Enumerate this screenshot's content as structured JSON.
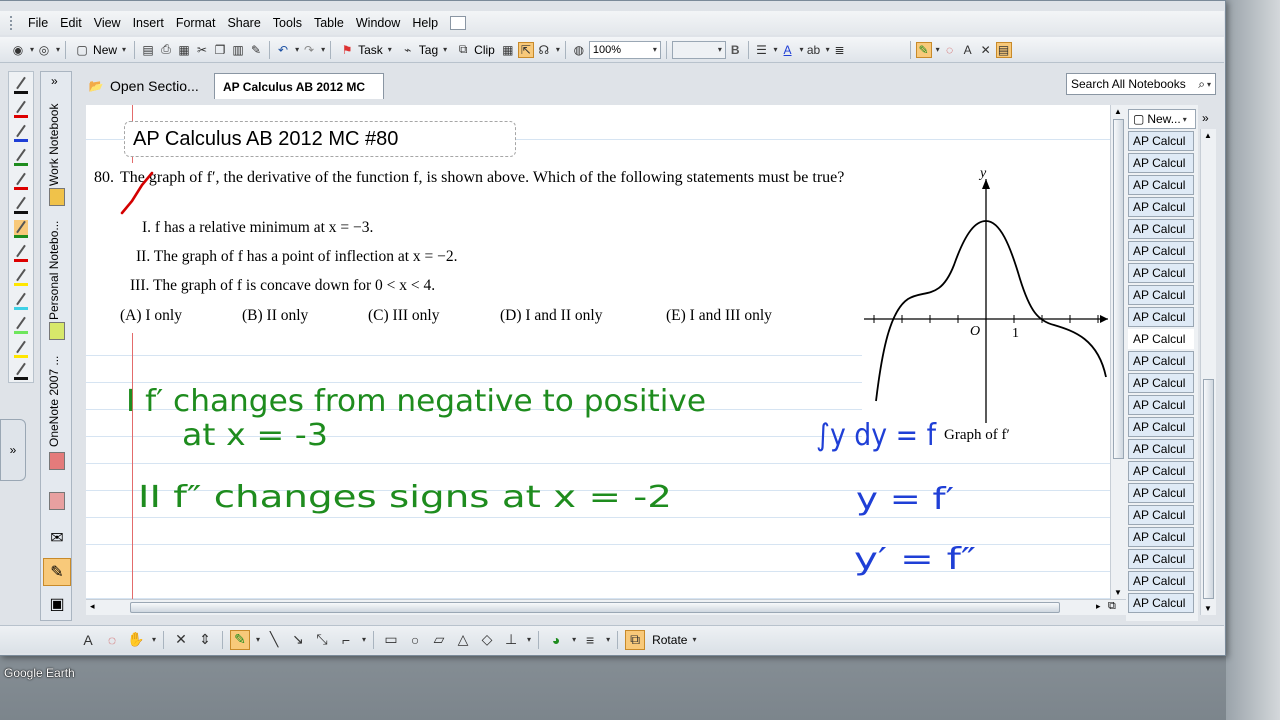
{
  "menu": [
    "File",
    "Edit",
    "View",
    "Insert",
    "Format",
    "Share",
    "Tools",
    "Table",
    "Window",
    "Help"
  ],
  "toolbar": {
    "new_label": "New",
    "task_label": "Task",
    "tag_label": "Tag",
    "clip_label": "Clip",
    "zoom_value": "100%",
    "bold_label": "B"
  },
  "tabs": {
    "open_sections": "Open Sectio...",
    "active_section": "AP Calculus AB 2012 MC"
  },
  "search": {
    "placeholder": "Search All Notebooks"
  },
  "navbar": {
    "notebooks": [
      "Work Notebook",
      "Personal Notebo...",
      "OneNote 2007 ..."
    ]
  },
  "page": {
    "title": "AP Calculus AB 2012 MC #80",
    "question_number": "80.",
    "question_stem": "The graph of f′, the derivative of the function f, is shown above. Which of the following statements must be true?",
    "statements": [
      "I. f has a relative minimum at x = −3.",
      "II. The graph of f has a point of inflection at x = −2.",
      "III. The graph of f is concave down for 0 < x < 4."
    ],
    "choices": [
      "(A) I only",
      "(B) II only",
      "(C) III only",
      "(D) I and II only",
      "(E) I and III only"
    ],
    "graph": {
      "y_label": "y",
      "origin_label": "O",
      "tick_label": "1",
      "caption": "Graph of f′"
    },
    "handwriting": {
      "line1": "I  f′ changes from negative to positive",
      "line2": "at x = -3",
      "line3": "II  f″ changes signs at x = -2",
      "side1": "∫y dy = f",
      "side2": "y = f′",
      "side3": "y′ = f″"
    }
  },
  "pagelist": {
    "new_label": "New...",
    "items": [
      "AP Calcul",
      "AP Calcul",
      "AP Calcul",
      "AP Calcul",
      "AP Calcul",
      "AP Calcul",
      "AP Calcul",
      "AP Calcul",
      "AP Calcul",
      "AP Calcul",
      "AP Calcul",
      "AP Calcul",
      "AP Calcul",
      "AP Calcul",
      "AP Calcul",
      "AP Calcul",
      "AP Calcul",
      "AP Calcul",
      "AP Calcul",
      "AP Calcul",
      "AP Calcul",
      "AP Calcul"
    ],
    "active_index": 9
  },
  "drawbar": {
    "rotate_label": "Rotate"
  },
  "desktop": {
    "label": "Google Earth"
  },
  "colors": {
    "ink_green": "#1e8c1e",
    "ink_blue": "#1f3fd6",
    "check_red": "#d40000",
    "margin_red": "#e36b6b"
  }
}
